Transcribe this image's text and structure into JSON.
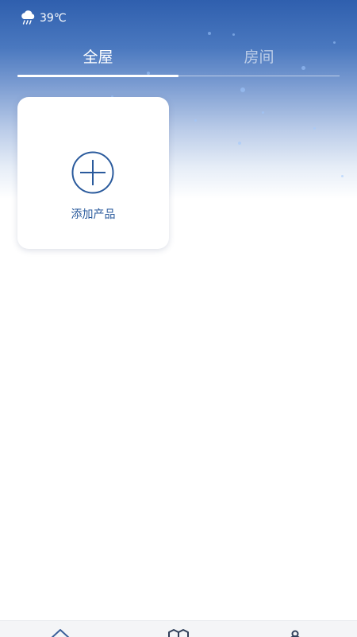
{
  "weather": {
    "icon": "cloud-rain-icon",
    "temperature": "39℃"
  },
  "tabs": [
    {
      "label": "全屋",
      "active": true
    },
    {
      "label": "房间",
      "active": false
    }
  ],
  "add_card": {
    "icon": "plus-circle-icon",
    "label": "添加产品"
  },
  "bottom_nav": [
    {
      "icon": "home-icon"
    },
    {
      "icon": "scene-icon"
    },
    {
      "icon": "user-icon"
    }
  ],
  "colors": {
    "header_blue": "#2f5fae",
    "accent": "#2a5a9c",
    "background": "#ffffff"
  }
}
